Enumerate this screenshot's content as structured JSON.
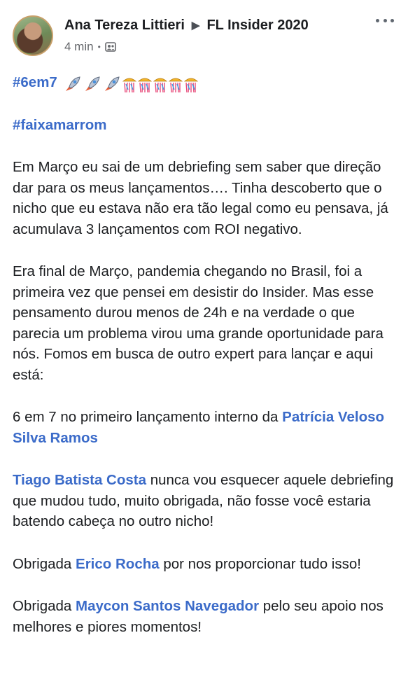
{
  "post": {
    "author": "Ana Tereza Littieri",
    "arrow": "▶",
    "group": "FL Insider 2020",
    "time": "4 min",
    "separator": "•",
    "hashtag1": "#6em7",
    "emoji_rockets": "🚀🚀🚀",
    "emoji_celebrate": "🎊🎊🎊🎊🎊",
    "hashtag2": "#faixamarrom",
    "para1": "Em Março eu sai de um debriefing sem saber que direção dar para os meus lançamentos…. Tinha descoberto que o nicho que eu estava não era tão legal como eu pensava, já acumulava 3 lançamentos com ROI negativo.",
    "para2": "Era final de Março, pandemia chegando no Brasil, foi a primeira vez que pensei em desistir do Insider. Mas esse pensamento durou menos de 24h e na verdade o que parecia um problema virou uma grande oportunidade para nós. Fomos em busca de outro expert para lançar e aqui está:",
    "para3_text": "6 em 7 no primeiro lançamento interno da ",
    "para3_mention": "Patrícia Veloso Silva Ramos",
    "para4_mention": "Tiago Batista Costa",
    "para4_text": " nunca vou esquecer aquele debriefing que mudou tudo, muito obrigada, não fosse você estaria batendo cabeça no outro nicho!",
    "para5_pre": "Obrigada ",
    "para5_mention": "Erico Rocha",
    "para5_post": " por nos proporcionar tudo isso!",
    "para6_pre": "Obrigada ",
    "para6_mention": "Maycon Santos Navegador",
    "para6_post": " pelo seu apoio nos melhores e piores momentos!"
  },
  "icons": {
    "more": "more-options-icon",
    "group": "group-audience-icon",
    "rocket": "rocket-emoji-icon",
    "confetti": "confetti-emoji-icon"
  },
  "colors": {
    "link": "#3b6bc9",
    "text": "#1c1e21",
    "meta": "#65676b"
  }
}
